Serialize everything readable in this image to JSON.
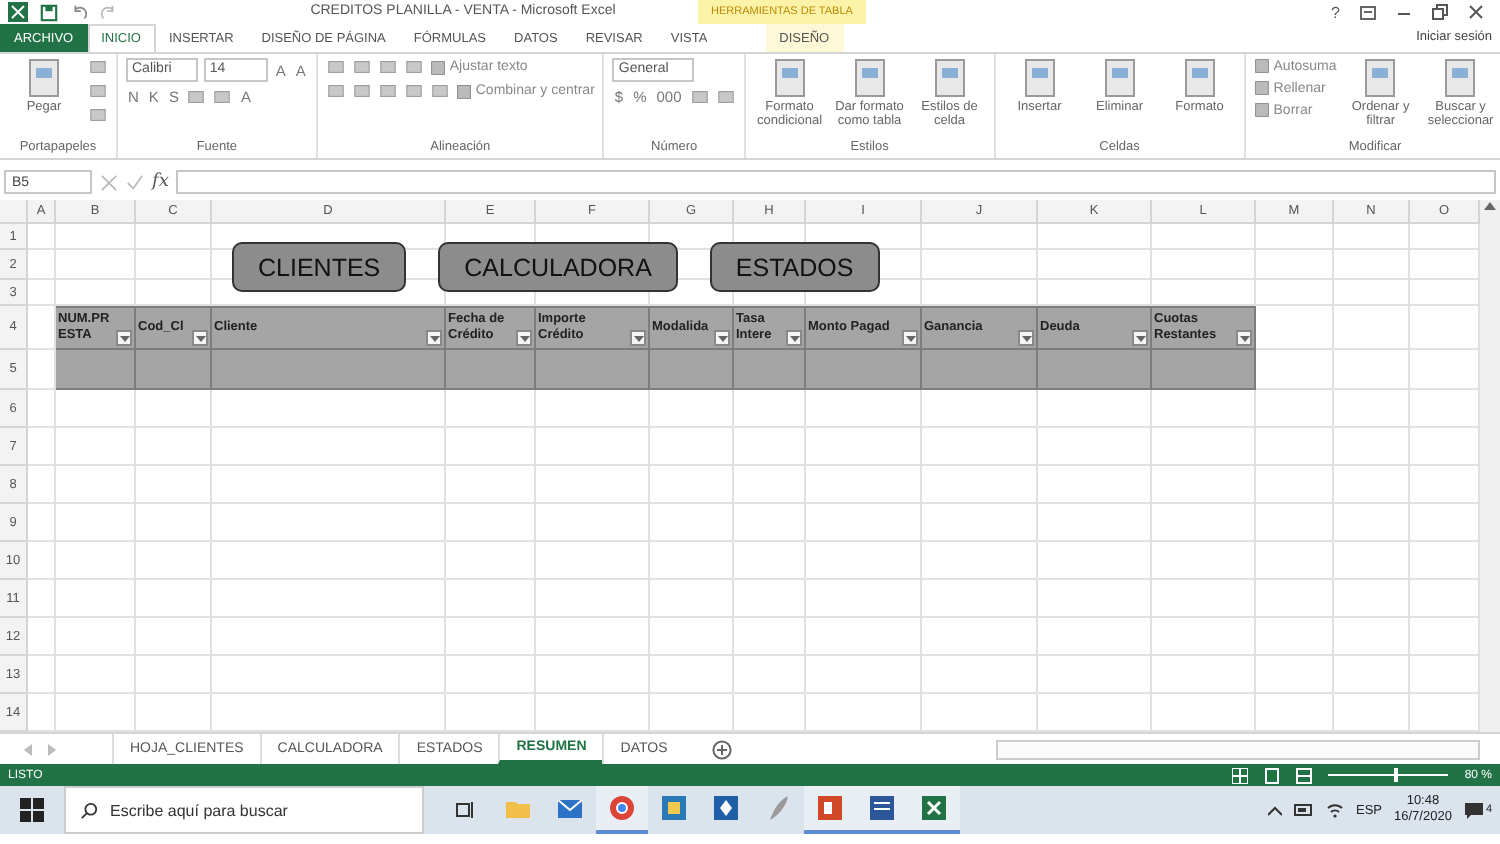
{
  "window": {
    "title": "CREDITOS PLANILLA - VENTA - Microsoft Excel",
    "context_label": "HERRAMIENTAS DE TABLA",
    "help": "?",
    "sign_in": "Iniciar sesión"
  },
  "ribbon_tabs": [
    {
      "label": "ARCHIVO",
      "kind": "file",
      "selected": false
    },
    {
      "label": "INICIO",
      "kind": "standard",
      "selected": true
    },
    {
      "label": "INSERTAR",
      "kind": "standard",
      "selected": false
    },
    {
      "label": "DISEÑO DE PÁGINA",
      "kind": "standard",
      "selected": false
    },
    {
      "label": "FÓRMULAS",
      "kind": "standard",
      "selected": false
    },
    {
      "label": "DATOS",
      "kind": "standard",
      "selected": false
    },
    {
      "label": "REVISAR",
      "kind": "standard",
      "selected": false
    },
    {
      "label": "VISTA",
      "kind": "standard",
      "selected": false
    },
    {
      "label": "DISEÑO",
      "kind": "contextual",
      "selected": false
    }
  ],
  "ribbon_groups": [
    {
      "name": "Portapapeles",
      "items": [
        {
          "kind": "large",
          "label": "Pegar"
        },
        {
          "kind": "stack",
          "rows": [
            {
              "items": [
                {
                  "kind": "icon"
                }
              ]
            },
            {
              "items": [
                {
                  "kind": "icon"
                }
              ]
            },
            {
              "items": [
                {
                  "kind": "icon"
                }
              ]
            }
          ]
        }
      ]
    },
    {
      "name": "Fuente",
      "items": [
        {
          "kind": "stack",
          "rows": [
            {
              "items": [
                {
                  "kind": "field",
                  "value": "Calibri"
                },
                {
                  "kind": "field",
                  "value": "14"
                },
                {
                  "kind": "glyph",
                  "label": "A"
                },
                {
                  "kind": "glyph",
                  "label": "A"
                }
              ]
            },
            {
              "items": [
                {
                  "kind": "glyph",
                  "label": "N"
                },
                {
                  "kind": "glyph",
                  "label": "K"
                },
                {
                  "kind": "glyph",
                  "label": "S"
                },
                {
                  "kind": "icon"
                },
                {
                  "kind": "icon"
                },
                {
                  "kind": "glyph",
                  "label": "A"
                }
              ]
            }
          ]
        }
      ]
    },
    {
      "name": "Alineación",
      "items": [
        {
          "kind": "stack",
          "rows": [
            {
              "items": [
                {
                  "kind": "icon"
                },
                {
                  "kind": "icon"
                },
                {
                  "kind": "icon"
                },
                {
                  "kind": "icon"
                },
                {
                  "kind": "text",
                  "label": "Ajustar texto"
                }
              ]
            },
            {
              "items": [
                {
                  "kind": "icon"
                },
                {
                  "kind": "icon"
                },
                {
                  "kind": "icon"
                },
                {
                  "kind": "icon"
                },
                {
                  "kind": "icon"
                },
                {
                  "kind": "text",
                  "label": "Combinar y centrar"
                }
              ]
            }
          ]
        }
      ]
    },
    {
      "name": "Número",
      "items": [
        {
          "kind": "stack",
          "rows": [
            {
              "items": [
                {
                  "kind": "field",
                  "value": "General"
                }
              ]
            },
            {
              "items": [
                {
                  "kind": "glyph",
                  "label": "$"
                },
                {
                  "kind": "glyph",
                  "label": "%"
                },
                {
                  "kind": "glyph",
                  "label": "000"
                },
                {
                  "kind": "icon"
                },
                {
                  "kind": "icon"
                }
              ]
            }
          ]
        }
      ]
    },
    {
      "name": "Estilos",
      "items": [
        {
          "kind": "large",
          "label": "Formato condicional"
        },
        {
          "kind": "large",
          "label": "Dar formato como tabla"
        },
        {
          "kind": "large",
          "label": "Estilos de celda"
        }
      ]
    },
    {
      "name": "Celdas",
      "items": [
        {
          "kind": "large",
          "label": "Insertar"
        },
        {
          "kind": "large",
          "label": "Eliminar"
        },
        {
          "kind": "large",
          "label": "Formato"
        }
      ]
    },
    {
      "name": "Modificar",
      "items": [
        {
          "kind": "stack",
          "rows": [
            {
              "items": [
                {
                  "kind": "text",
                  "label": "Autosuma"
                }
              ]
            },
            {
              "items": [
                {
                  "kind": "text",
                  "label": "Rellenar"
                }
              ]
            },
            {
              "items": [
                {
                  "kind": "text",
                  "label": "Borrar"
                }
              ]
            }
          ]
        },
        {
          "kind": "large",
          "label": "Ordenar y filtrar"
        },
        {
          "kind": "large",
          "label": "Buscar y seleccionar"
        }
      ]
    }
  ],
  "formula_bar": {
    "name_box": "B5",
    "function_label": "fx"
  },
  "sheet": {
    "columns": [
      "A",
      "B",
      "C",
      "D",
      "E",
      "F",
      "G",
      "H",
      "I",
      "J",
      "K",
      "L",
      "M",
      "N",
      "O"
    ],
    "rows": [
      "1",
      "2",
      "3",
      "4",
      "5",
      "6",
      "7",
      "8",
      "9",
      "10",
      "11",
      "12",
      "13",
      "14"
    ],
    "buttons": [
      "CLIENTES",
      "CALCULADORA",
      "ESTADOS"
    ],
    "table_headers": [
      "NUM.PR ESTA",
      "Cod_Cl",
      "Cliente",
      "Fecha de Crédito",
      "Importe Crédito",
      "Modalida",
      "Tasa Intere",
      "Monto Pagad",
      "Ganancia",
      "Deuda",
      "Cuotas Restantes"
    ]
  },
  "sheet_tabs": [
    {
      "label": "HOJA_CLIENTES",
      "selected": false
    },
    {
      "label": "CALCULADORA",
      "selected": false
    },
    {
      "label": "ESTADOS",
      "selected": false
    },
    {
      "label": "RESUMEN",
      "selected": true
    },
    {
      "label": "DATOS",
      "selected": false
    }
  ],
  "status_bar": {
    "mode": "LISTO",
    "zoom": "80 %",
    "zoom_level": {
      "level": 0.55
    }
  },
  "taskbar": {
    "search_placeholder": "Escribe aquí para buscar",
    "apps": [
      {
        "kind": "folder",
        "running": false
      },
      {
        "kind": "mail",
        "running": false
      },
      {
        "kind": "browser",
        "running": true
      },
      {
        "kind": "tile",
        "running": false
      },
      {
        "kind": "store",
        "running": false
      },
      {
        "kind": "feather",
        "running": false
      },
      {
        "kind": "slides",
        "running": true
      },
      {
        "kind": "doc",
        "running": true
      },
      {
        "kind": "sheet",
        "running": true
      }
    ],
    "language": "ESP",
    "time": "10:48",
    "date": "16/7/2020",
    "notifications": "4"
  }
}
